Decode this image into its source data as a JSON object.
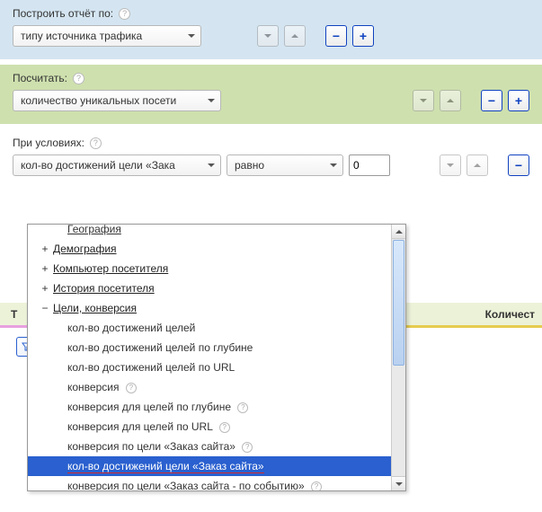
{
  "panel_build": {
    "label": "Построить отчёт по:",
    "select_value": "типу источника трафика"
  },
  "panel_calc": {
    "label": "Посчитать:",
    "select_value": "количество уникальных посети"
  },
  "panel_cond": {
    "label": "При условиях:",
    "select1_value": "кол-во достижений цели «Зака",
    "select2_value": "равно",
    "input_value": "0"
  },
  "dropdown": {
    "item_cut": "География",
    "groups": [
      {
        "sign": "+",
        "label": "Демография"
      },
      {
        "sign": "+",
        "label": "Компьютер посетителя"
      },
      {
        "sign": "+",
        "label": "История посетителя"
      },
      {
        "sign": "−",
        "label": "Цели, конверсия"
      }
    ],
    "children": [
      {
        "label": "кол-во достижений целей",
        "help": false
      },
      {
        "label": "кол-во достижений целей по глубине",
        "help": false
      },
      {
        "label": "кол-во достижений целей по URL",
        "help": false
      },
      {
        "label": "конверсия",
        "help": true
      },
      {
        "label": "конверсия для целей по глубине",
        "help": true
      },
      {
        "label": "конверсия для целей по URL",
        "help": true
      },
      {
        "label": "конверсия по цели «Заказ сайта»",
        "help": true
      },
      {
        "label": "кол-во достижений цели «Заказ сайта»",
        "help": false,
        "selected": true,
        "redline": true
      },
      {
        "label": "конверсия по цели «Заказ сайта - по событию»",
        "help": true
      }
    ]
  },
  "table": {
    "col_left_first_char": "Т",
    "col_right": "Количест"
  },
  "comma": ","
}
